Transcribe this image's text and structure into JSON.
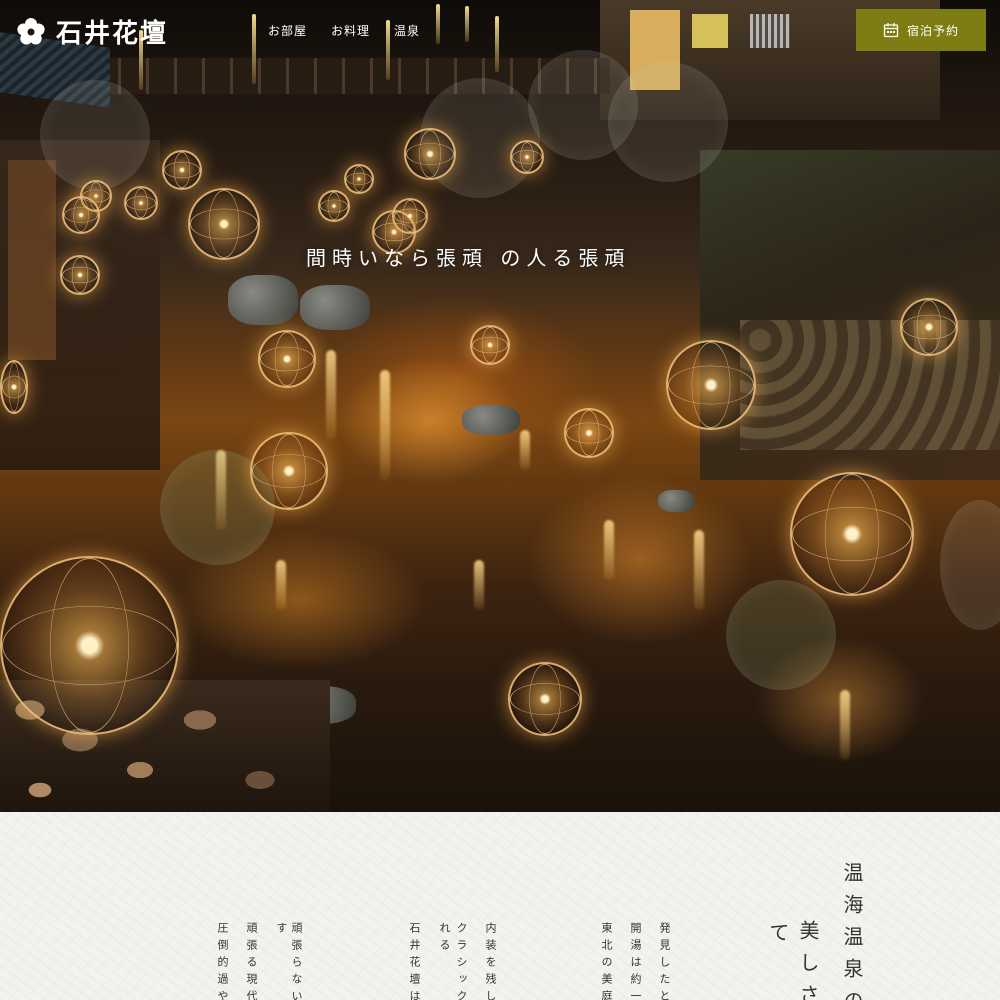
{
  "header": {
    "logo_text": "石井花壇",
    "nav": [
      "お部屋",
      "お料理",
      "温泉"
    ],
    "reserve_label": "宿泊予約",
    "brand_color": "#7e7d14"
  },
  "hero": {
    "catch_copy": "間時いなら張頑 の人る張頑"
  },
  "intro": {
    "title_line1": "温海温泉の",
    "title_line2": "美しさ",
    "title_line3": "て",
    "columns": [
      "発見したと",
      "開湯は約一",
      "東北の美庭",
      "内装を残し",
      "クラシック",
      "れる",
      "石井花壇は",
      "頑張らない",
      "す",
      "頑張る現代",
      "圧倒的過や"
    ]
  }
}
